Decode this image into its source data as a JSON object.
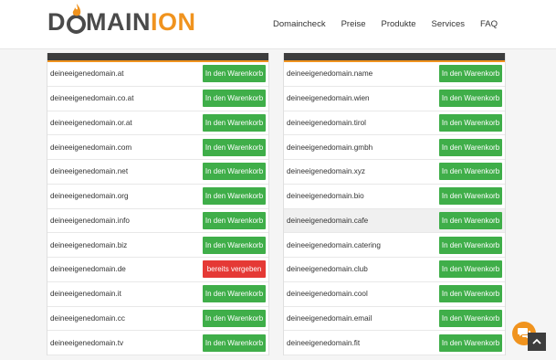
{
  "logo": {
    "part1": "D",
    "part2": "MAIN",
    "part3": "ION",
    "accent": "#f0931e"
  },
  "nav": [
    "Domaincheck",
    "Preise",
    "Produkte",
    "Services",
    "FAQ"
  ],
  "left": [
    {
      "domain": "deineeigenedomain.at",
      "action": "In den Warenkorb",
      "status": "available"
    },
    {
      "domain": "deineeigenedomain.co.at",
      "action": "In den Warenkorb",
      "status": "available"
    },
    {
      "domain": "deineeigenedomain.or.at",
      "action": "In den Warenkorb",
      "status": "available"
    },
    {
      "domain": "deineeigenedomain.com",
      "action": "In den Warenkorb",
      "status": "available"
    },
    {
      "domain": "deineeigenedomain.net",
      "action": "In den Warenkorb",
      "status": "available"
    },
    {
      "domain": "deineeigenedomain.org",
      "action": "In den Warenkorb",
      "status": "available"
    },
    {
      "domain": "deineeigenedomain.info",
      "action": "In den Warenkorb",
      "status": "available"
    },
    {
      "domain": "deineeigenedomain.biz",
      "action": "In den Warenkorb",
      "status": "available"
    },
    {
      "domain": "deineeigenedomain.de",
      "action": "bereits vergeben",
      "status": "taken"
    },
    {
      "domain": "deineeigenedomain.it",
      "action": "In den Warenkorb",
      "status": "available"
    },
    {
      "domain": "deineeigenedomain.cc",
      "action": "In den Warenkorb",
      "status": "available"
    },
    {
      "domain": "deineeigenedomain.tv",
      "action": "In den Warenkorb",
      "status": "available"
    }
  ],
  "right": [
    {
      "domain": "deineeigenedomain.name",
      "action": "In den Warenkorb",
      "status": "available"
    },
    {
      "domain": "deineeigenedomain.wien",
      "action": "In den Warenkorb",
      "status": "available"
    },
    {
      "domain": "deineeigenedomain.tirol",
      "action": "In den Warenkorb",
      "status": "available"
    },
    {
      "domain": "deineeigenedomain.gmbh",
      "action": "In den Warenkorb",
      "status": "available"
    },
    {
      "domain": "deineeigenedomain.xyz",
      "action": "In den Warenkorb",
      "status": "available"
    },
    {
      "domain": "deineeigenedomain.bio",
      "action": "In den Warenkorb",
      "status": "available"
    },
    {
      "domain": "deineeigenedomain.cafe",
      "action": "In den Warenkorb",
      "status": "available",
      "highlighted": true
    },
    {
      "domain": "deineeigenedomain.catering",
      "action": "In den Warenkorb",
      "status": "available"
    },
    {
      "domain": "deineeigenedomain.club",
      "action": "In den Warenkorb",
      "status": "available"
    },
    {
      "domain": "deineeigenedomain.cool",
      "action": "In den Warenkorb",
      "status": "available"
    },
    {
      "domain": "deineeigenedomain.email",
      "action": "In den Warenkorb",
      "status": "available"
    },
    {
      "domain": "deineeigenedomain.fit",
      "action": "In den Warenkorb",
      "status": "available"
    }
  ],
  "icons": {
    "chat": "chat-bubble-icon",
    "scroll_top": "chevron-up-icon"
  }
}
